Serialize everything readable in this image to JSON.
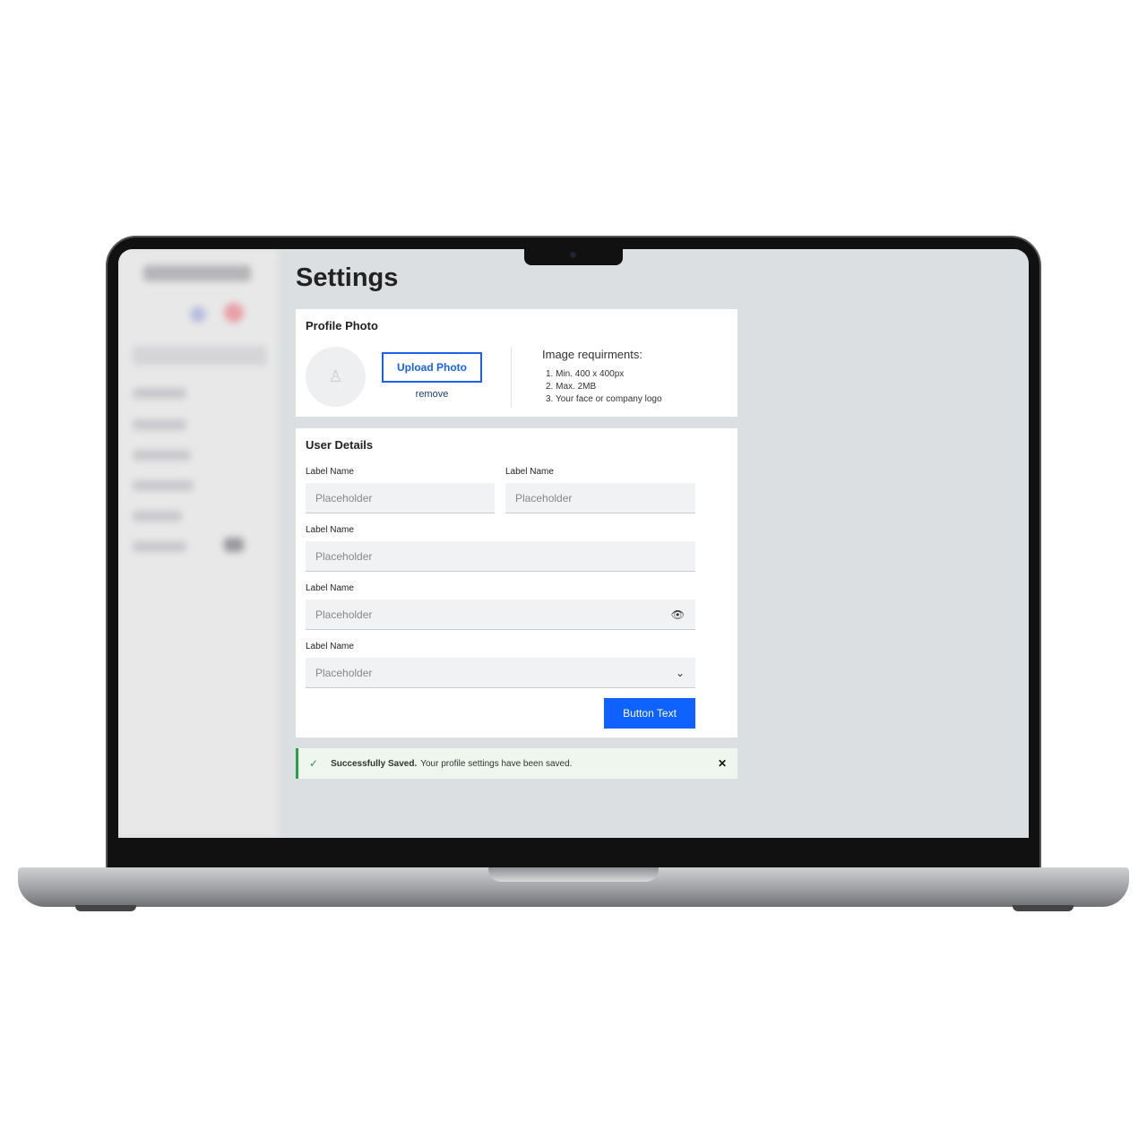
{
  "page": {
    "title": "Settings"
  },
  "profile_photo": {
    "heading": "Profile Photo",
    "upload_label": "Upload Photo",
    "remove_label": "remove",
    "requirements_title": "Image requirments:",
    "requirements": [
      "1.  Min.  400 x 400px",
      "2.  Max. 2MB",
      "3.  Your face or company logo"
    ]
  },
  "user_details": {
    "heading": "User Details",
    "fields": [
      {
        "label": "Label Name",
        "placeholder": "Placeholder"
      },
      {
        "label": "Label Name",
        "placeholder": "Placeholder"
      },
      {
        "label": "Label Name",
        "placeholder": "Placeholder"
      },
      {
        "label": "Label Name",
        "placeholder": "Placeholder",
        "icon": "eye-icon"
      },
      {
        "label": "Label Name",
        "placeholder": "Placeholder",
        "icon": "chevron-down-icon"
      }
    ],
    "button_label": "Button Text"
  },
  "toast": {
    "title": "Successfully Saved.",
    "message": "Your profile settings have been saved.",
    "close": "✕",
    "check": "✓"
  },
  "colors": {
    "accent": "#0f62fe",
    "success": "#24a148"
  }
}
